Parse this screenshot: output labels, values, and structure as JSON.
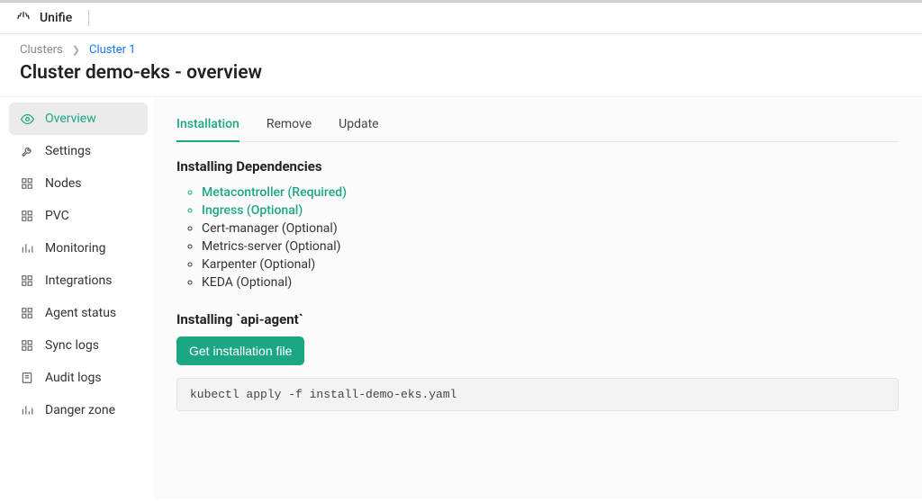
{
  "brand": {
    "name": "Unifie"
  },
  "breadcrumb": {
    "root": "Clusters",
    "current": "Cluster 1"
  },
  "page": {
    "title": "Cluster demo-eks - overview"
  },
  "sidebar": {
    "items": [
      {
        "label": "Overview"
      },
      {
        "label": "Settings"
      },
      {
        "label": "Nodes"
      },
      {
        "label": "PVC"
      },
      {
        "label": "Monitoring"
      },
      {
        "label": "Integrations"
      },
      {
        "label": "Agent status"
      },
      {
        "label": "Sync logs"
      },
      {
        "label": "Audit logs"
      },
      {
        "label": "Danger zone"
      }
    ]
  },
  "tabs": [
    {
      "label": "Installation"
    },
    {
      "label": "Remove"
    },
    {
      "label": "Update"
    }
  ],
  "deps": {
    "heading": "Installing Dependencies",
    "items": [
      {
        "label": "Metacontroller (Required)",
        "link": true
      },
      {
        "label": "Ingress (Optional)",
        "link": true
      },
      {
        "label": "Cert-manager (Optional)",
        "link": false
      },
      {
        "label": "Metrics-server (Optional)",
        "link": false
      },
      {
        "label": "Karpenter (Optional)",
        "link": false
      },
      {
        "label": "KEDA (Optional)",
        "link": false
      }
    ]
  },
  "install": {
    "heading": "Installing `api-agent`",
    "button": "Get installation file",
    "command": "kubectl apply -f install-demo-eks.yaml"
  }
}
